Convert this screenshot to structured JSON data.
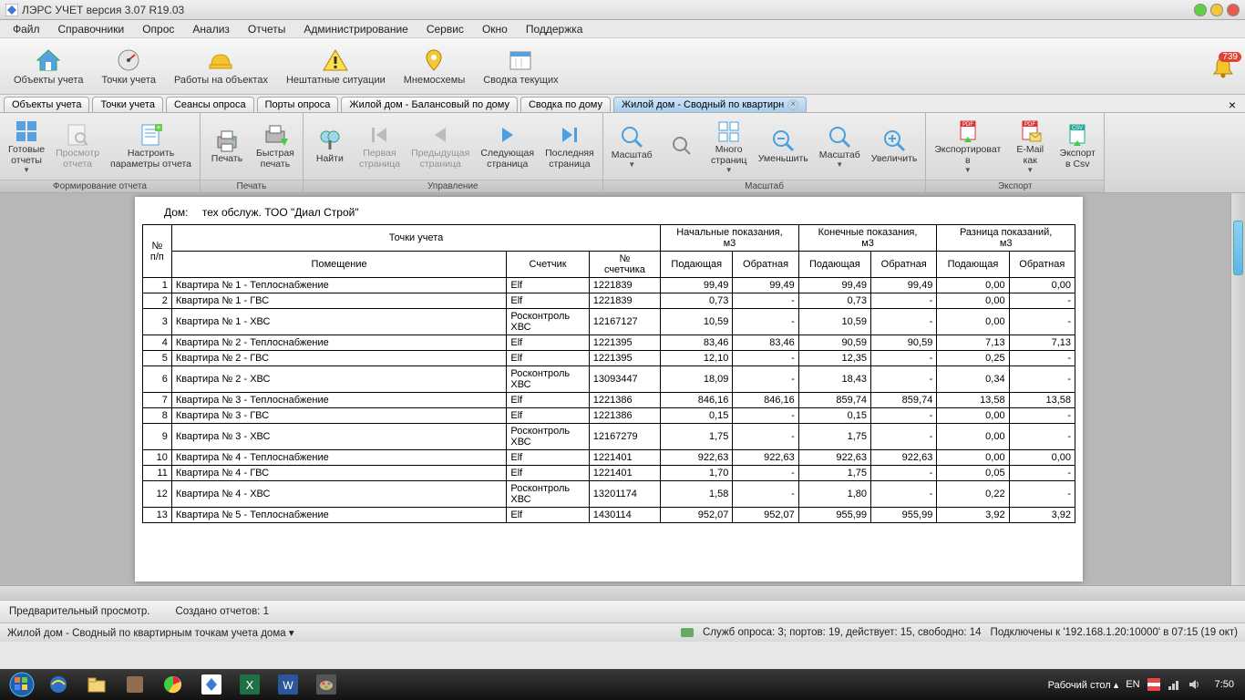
{
  "titlebar": {
    "title": "ЛЭРС УЧЕТ версия 3.07 R19.03"
  },
  "menu": [
    "Файл",
    "Справочники",
    "Опрос",
    "Анализ",
    "Отчеты",
    "Администрирование",
    "Сервис",
    "Окно",
    "Поддержка"
  ],
  "toolbar": {
    "items": [
      "Объекты учета",
      "Точки учета",
      "Работы на объектах",
      "Нештатные ситуации",
      "Мнемосхемы",
      "Сводка текущих"
    ],
    "badge": "739"
  },
  "doctabs": {
    "tabs": [
      "Объекты учета",
      "Точки учета",
      "Сеансы опроса",
      "Порты опроса",
      "Жилой дом - Балансовый по дому",
      "Сводка по дому",
      "Жилой дом - Сводный по квартирн"
    ],
    "activeIndex": 6
  },
  "ribbon": {
    "groups": [
      {
        "label": "Формирование отчета",
        "buttons": [
          {
            "label": "Готовые\nотчеты",
            "dd": true
          },
          {
            "label": "Просмотр\nотчета",
            "disabled": true
          },
          {
            "label": "Настроить\nпараметры отчета"
          }
        ]
      },
      {
        "label": "Печать",
        "buttons": [
          {
            "label": "Печать"
          },
          {
            "label": "Быстрая\nпечать"
          }
        ]
      },
      {
        "label": "Управление",
        "buttons": [
          {
            "label": "Найти"
          },
          {
            "label": "Первая\nстраница",
            "disabled": true
          },
          {
            "label": "Предыдущая\nстраница",
            "disabled": true
          },
          {
            "label": "Следующая\nстраница"
          },
          {
            "label": "Последняя\nстраница"
          }
        ]
      },
      {
        "label": "Масштаб",
        "buttons": [
          {
            "label": "Масштаб",
            "dd": true
          },
          {
            "label": ""
          },
          {
            "label": "Много\nстраниц",
            "dd": true
          },
          {
            "label": "Уменьшить"
          },
          {
            "label": "Масштаб",
            "dd": true
          },
          {
            "label": "Увеличить"
          }
        ]
      },
      {
        "label": "Экспорт",
        "buttons": [
          {
            "label": "Экспортироват\nв",
            "dd": true
          },
          {
            "label": "E-Mail\nкак",
            "dd": true
          },
          {
            "label": "Экспорт\nв Csv"
          }
        ]
      }
    ]
  },
  "report": {
    "house_label": "Дом:",
    "house_value": "тех обслуж. ТОО \"Диал Строй\"",
    "head": {
      "points": "Точки учета",
      "np": "№\nп/п",
      "room": "Помещение",
      "meter": "Счетчик",
      "meter_no": "№\nсчетчика",
      "initial": "Начальные показания,\nм3",
      "final": "Конечные показания,\nм3",
      "diff": "Разница показаний,\nм3",
      "supply": "Подающая",
      "return": "Обратная"
    },
    "rows": [
      {
        "n": "1",
        "room": "Квартира № 1 - Теплоснабжение",
        "meter": "Elf",
        "mno": "1221839",
        "is": "99,49",
        "ir": "99,49",
        "fs": "99,49",
        "fr": "99,49",
        "ds": "0,00",
        "dr": "0,00"
      },
      {
        "n": "2",
        "room": "Квартира № 1 - ГВС",
        "meter": "Elf",
        "mno": "1221839",
        "is": "0,73",
        "ir": "-",
        "fs": "0,73",
        "fr": "-",
        "ds": "0,00",
        "dr": "-"
      },
      {
        "n": "3",
        "room": "Квартира № 1 - ХВС",
        "meter": "Росконтроль ХВС",
        "mno": "12167127",
        "is": "10,59",
        "ir": "-",
        "fs": "10,59",
        "fr": "-",
        "ds": "0,00",
        "dr": "-"
      },
      {
        "n": "4",
        "room": "Квартира № 2 - Теплоснабжение",
        "meter": "Elf",
        "mno": "1221395",
        "is": "83,46",
        "ir": "83,46",
        "fs": "90,59",
        "fr": "90,59",
        "ds": "7,13",
        "dr": "7,13"
      },
      {
        "n": "5",
        "room": "Квартира № 2 - ГВС",
        "meter": "Elf",
        "mno": "1221395",
        "is": "12,10",
        "ir": "-",
        "fs": "12,35",
        "fr": "-",
        "ds": "0,25",
        "dr": "-"
      },
      {
        "n": "6",
        "room": "Квартира № 2 - ХВС",
        "meter": "Росконтроль ХВС",
        "mno": "13093447",
        "is": "18,09",
        "ir": "-",
        "fs": "18,43",
        "fr": "-",
        "ds": "0,34",
        "dr": "-"
      },
      {
        "n": "7",
        "room": "Квартира № 3 - Теплоснабжение",
        "meter": "Elf",
        "mno": "1221386",
        "is": "846,16",
        "ir": "846,16",
        "fs": "859,74",
        "fr": "859,74",
        "ds": "13,58",
        "dr": "13,58"
      },
      {
        "n": "8",
        "room": "Квартира № 3 - ГВС",
        "meter": "Elf",
        "mno": "1221386",
        "is": "0,15",
        "ir": "-",
        "fs": "0,15",
        "fr": "-",
        "ds": "0,00",
        "dr": "-"
      },
      {
        "n": "9",
        "room": "Квартира № 3 - ХВС",
        "meter": "Росконтроль ХВС",
        "mno": "12167279",
        "is": "1,75",
        "ir": "-",
        "fs": "1,75",
        "fr": "-",
        "ds": "0,00",
        "dr": "-"
      },
      {
        "n": "10",
        "room": "Квартира № 4 - Теплоснабжение",
        "meter": "Elf",
        "mno": "1221401",
        "is": "922,63",
        "ir": "922,63",
        "fs": "922,63",
        "fr": "922,63",
        "ds": "0,00",
        "dr": "0,00"
      },
      {
        "n": "11",
        "room": "Квартира № 4 - ГВС",
        "meter": "Elf",
        "mno": "1221401",
        "is": "1,70",
        "ir": "-",
        "fs": "1,75",
        "fr": "-",
        "ds": "0,05",
        "dr": "-"
      },
      {
        "n": "12",
        "room": "Квартира № 4 - ХВС",
        "meter": "Росконтроль ХВС",
        "mno": "13201174",
        "is": "1,58",
        "ir": "-",
        "fs": "1,80",
        "fr": "-",
        "ds": "0,22",
        "dr": "-"
      },
      {
        "n": "13",
        "room": "Квартира № 5 - Теплоснабжение",
        "meter": "Elf",
        "mno": "1430114",
        "is": "952,07",
        "ir": "952,07",
        "fs": "955,99",
        "fr": "955,99",
        "ds": "3,92",
        "dr": "3,92"
      }
    ]
  },
  "status1": {
    "preview": "Предварительный просмотр.",
    "created": "Создано отчетов: 1"
  },
  "status2": {
    "left": "Жилой дом - Сводный по квартирным точкам учета дома ▾",
    "service": "Служб опроса: 3; портов: 19, действует: 15, свободно: 14",
    "conn": "Подключены к '192.168.1.20:10000' в 07:15 (19 окт)"
  },
  "taskbar": {
    "desktop": "Рабочий стол ▴",
    "lang": "EN",
    "time": "7:50"
  }
}
